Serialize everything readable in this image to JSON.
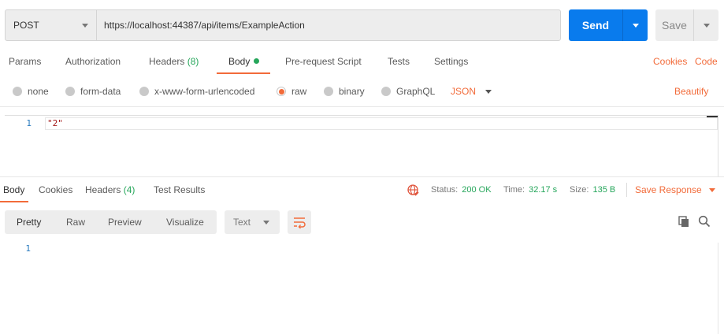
{
  "request": {
    "method": "POST",
    "url": "https://localhost:44387/api/items/ExampleAction",
    "send_label": "Send",
    "save_label": "Save"
  },
  "request_tabs": {
    "params": "Params",
    "authorization": "Authorization",
    "headers": "Headers",
    "headers_count": "(8)",
    "body": "Body",
    "prerequest": "Pre-request Script",
    "tests": "Tests",
    "settings": "Settings",
    "cookies": "Cookies",
    "code": "Code"
  },
  "body_types": {
    "none": "none",
    "form_data": "form-data",
    "urlencoded": "x-www-form-urlencoded",
    "raw": "raw",
    "binary": "binary",
    "graphql": "GraphQL",
    "selected": "raw",
    "language": "JSON",
    "beautify": "Beautify"
  },
  "editor": {
    "line_number": "1",
    "content": "\"2\""
  },
  "response_tabs": {
    "body": "Body",
    "cookies": "Cookies",
    "headers": "Headers",
    "headers_count": "(4)",
    "test_results": "Test Results"
  },
  "response_status": {
    "status_label": "Status:",
    "status_value": "200 OK",
    "time_label": "Time:",
    "time_value": "32.17 s",
    "size_label": "Size:",
    "size_value": "135 B",
    "save_response": "Save Response"
  },
  "response_toolbar": {
    "pretty": "Pretty",
    "raw": "Raw",
    "preview": "Preview",
    "visualize": "Visualize",
    "format": "Text"
  },
  "response_body": {
    "line_number": "1"
  },
  "colors": {
    "accent": "#f26b3a",
    "send_blue": "#097bed",
    "success_green": "#26a65b"
  },
  "icons": {
    "method_dropdown": "chevron-down-icon",
    "send_dropdown": "chevron-down-icon",
    "save_dropdown": "chevron-down-icon",
    "globe": "globe-icon",
    "wrap": "wrap-lines-icon",
    "copy": "copy-icon",
    "search": "search-icon"
  }
}
